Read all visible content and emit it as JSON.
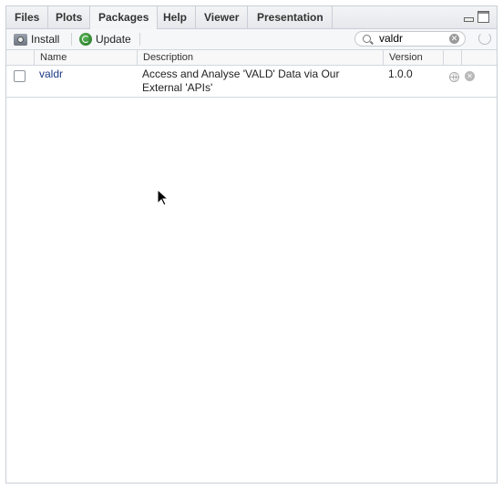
{
  "tabs": [
    {
      "label": "Files"
    },
    {
      "label": "Plots"
    },
    {
      "label": "Packages"
    },
    {
      "label": "Help"
    },
    {
      "label": "Viewer"
    },
    {
      "label": "Presentation"
    }
  ],
  "active_tab": "Packages",
  "toolbar": {
    "install_label": "Install",
    "update_label": "Update",
    "search_value": "valdr"
  },
  "table": {
    "columns": [
      "Name",
      "Description",
      "Version"
    ],
    "rows": [
      {
        "name": "valdr",
        "description_line1": "Access and Analyse 'VALD' Data via Our",
        "description_line2": "External 'APIs'",
        "version": "1.0.0",
        "checked": false
      }
    ]
  },
  "icons": {
    "install": "install-icon",
    "update": "update-icon",
    "search": "search-icon",
    "clear": "clear-search-icon",
    "refresh": "refresh-icon",
    "globe": "globe-icon",
    "remove": "remove-package-icon",
    "cursor": "mouse-cursor-icon"
  },
  "colors": {
    "link": "#1b3a85",
    "update_green": "#2e8b2e",
    "border": "#c9ced6"
  }
}
